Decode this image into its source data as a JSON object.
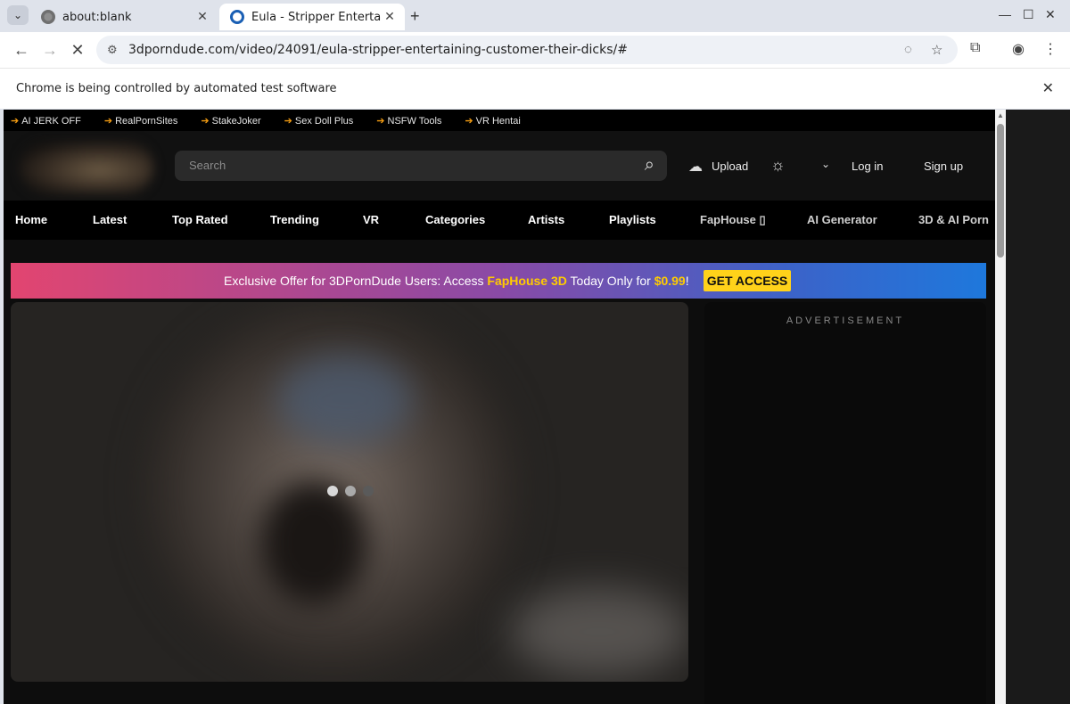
{
  "browser": {
    "tabs": [
      {
        "title": "about:blank"
      },
      {
        "title": "Eula - Stripper Entertaining"
      }
    ],
    "url": "3dporndude.com/video/24091/eula-stripper-entertaining-customer-their-dicks/#",
    "infobar_message": "Chrome is being controlled by automated test software"
  },
  "site": {
    "top_links": [
      "AI JERK OFF",
      "RealPornSites",
      "StakeJoker",
      "Sex Doll Plus",
      "NSFW Tools",
      "VR Hentai"
    ],
    "search_placeholder": "Search",
    "upload_label": "Upload",
    "login_label": "Log in",
    "signup_label": "Sign up",
    "nav": [
      "Home",
      "Latest",
      "Top Rated",
      "Trending",
      "VR",
      "Categories",
      "Artists",
      "Playlists",
      "FapHouse ▯",
      "AI Generator",
      "3D & AI Porn"
    ],
    "banner": {
      "prefix": "Exclusive Offer for 3DPornDude Users: Access ",
      "brand": "FapHouse 3D",
      "middle": " Today Only for ",
      "price": "$0.99",
      "suffix": "!",
      "cta": "GET ACCESS"
    },
    "ad_label": "ADVERTISEMENT"
  },
  "colors": {
    "accent_arrow": "#f39c12",
    "cta_yellow": "#ffd21a",
    "banner_highlight": "#ffcc00"
  }
}
